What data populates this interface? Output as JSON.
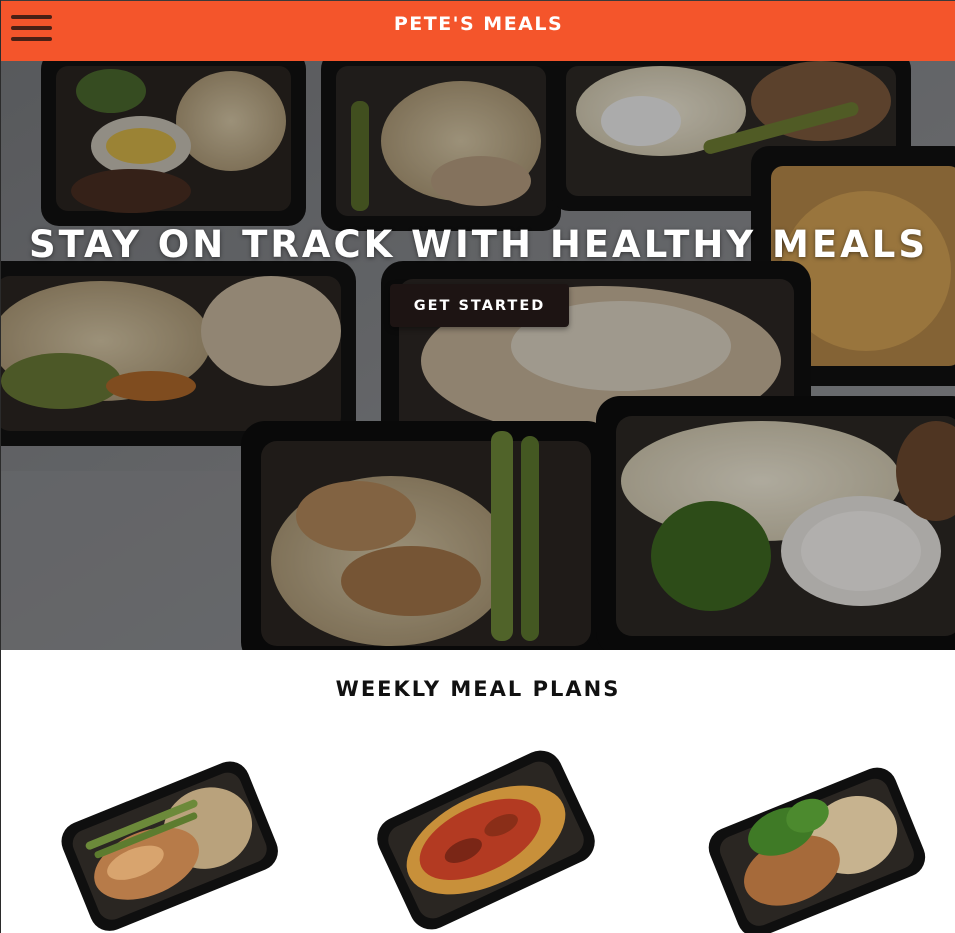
{
  "header": {
    "brand": "PETE'S MEALS",
    "menu_icon": "hamburger-menu-icon",
    "background_color": "#f4552b"
  },
  "hero": {
    "title": "STAY ON TRACK WITH HEALTHY MEALS",
    "cta_label": "GET STARTED",
    "cta_color": "#1d1413"
  },
  "plans": {
    "title": "WEEKLY MEAL PLANS",
    "items": [
      {
        "image": "chicken-asparagus-rice-meal"
      },
      {
        "image": "spaghetti-meat-sauce-meal"
      },
      {
        "image": "chicken-broccoli-rice-meal"
      }
    ]
  }
}
